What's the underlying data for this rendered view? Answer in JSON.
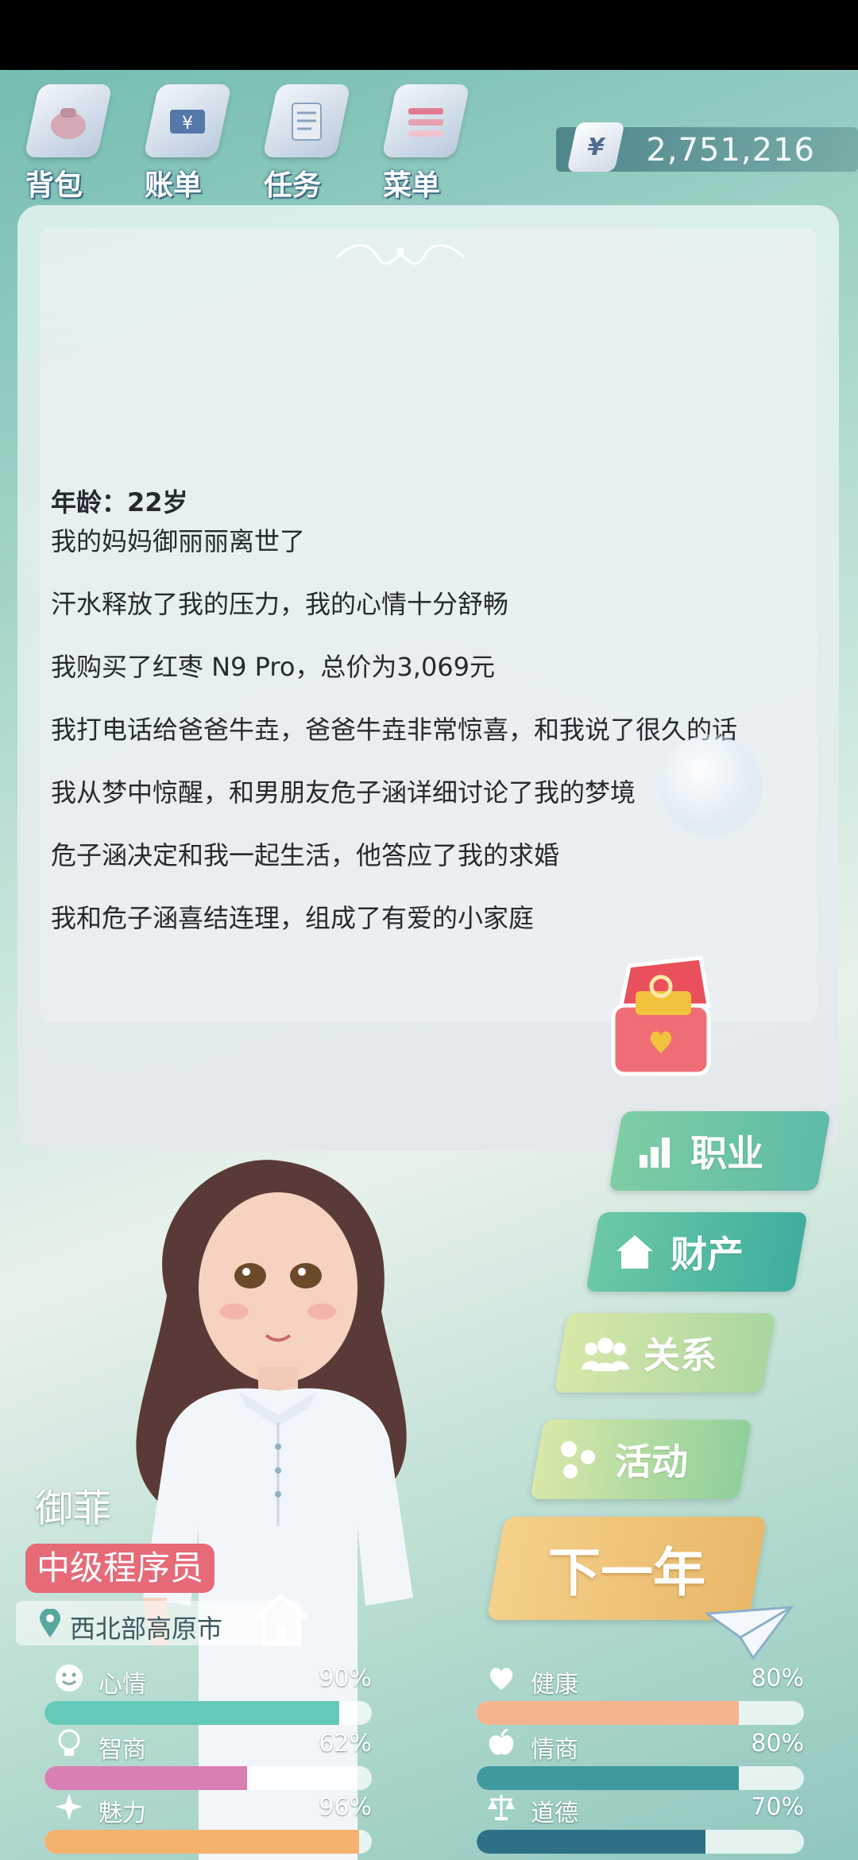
{
  "nav": [
    {
      "label": "背包",
      "icon": "backpack-icon"
    },
    {
      "label": "账单",
      "icon": "bill-icon"
    },
    {
      "label": "任务",
      "icon": "task-icon"
    },
    {
      "label": "菜单",
      "icon": "menu-icon"
    }
  ],
  "money": {
    "symbol": "¥",
    "value": "2,751,216"
  },
  "log": {
    "age": "年龄：22岁",
    "entries": [
      "我的妈妈御丽丽离世了",
      "汗水释放了我的压力，我的心情十分舒畅",
      "我购买了红枣 N9 Pro，总价为3,069元",
      "我打电话给爸爸牛垚，爸爸牛垚非常惊喜，和我说了很久的话",
      "我从梦中惊醒，和男朋友危子涵详细讨论了我的梦境",
      "危子涵决定和我一起生活，他答应了我的求婚",
      "我和危子涵喜结连理，组成了有爱的小家庭"
    ]
  },
  "menu": {
    "career": "职业",
    "assets": "财产",
    "relations": "关系",
    "activities": "活动",
    "next_year": "下一年"
  },
  "character": {
    "name": "御菲",
    "job": "中级程序员",
    "location": "西北部高原市"
  },
  "stats": [
    {
      "name": "心情",
      "value": "90%",
      "fraction": 0.9,
      "icon": "smile-icon",
      "color": "#64c9b8"
    },
    {
      "name": "健康",
      "value": "80%",
      "fraction": 0.8,
      "icon": "heart-icon",
      "color": "#f6b48f"
    },
    {
      "name": "智商",
      "value": "62%",
      "fraction": 0.62,
      "icon": "lightbulb-icon",
      "color": "#d97fb4"
    },
    {
      "name": "情商",
      "value": "80%",
      "fraction": 0.8,
      "icon": "apple-icon",
      "color": "#3f9aa0"
    },
    {
      "name": "魅力",
      "value": "96%",
      "fraction": 0.96,
      "icon": "sparkle-icon",
      "color": "#f4b26f"
    },
    {
      "name": "道德",
      "value": "70%",
      "fraction": 0.7,
      "icon": "scales-icon",
      "color": "#2f6f88"
    }
  ]
}
